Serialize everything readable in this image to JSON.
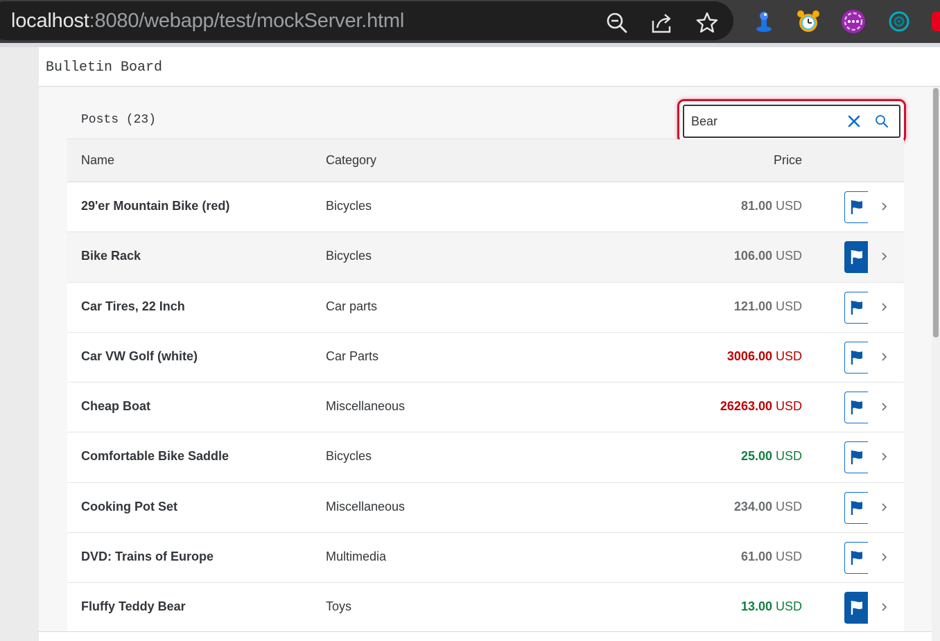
{
  "browser": {
    "url_host": "localhost",
    "url_rest": ":8080/webapp/test/mockServer.html",
    "icons": [
      "zoom-out-icon",
      "share-icon",
      "bookmark-star-icon"
    ],
    "extensions": [
      "inspector-extension-icon",
      "alarm-clock-extension-icon",
      "purple-extension-icon",
      "teal-extension-icon"
    ]
  },
  "app": {
    "title": "Bulletin Board"
  },
  "table": {
    "title": "Posts (23)",
    "search": {
      "value": "Bear",
      "placeholder": "Search"
    },
    "columns": {
      "name": "Name",
      "category": "Category",
      "price": "Price"
    },
    "rows": [
      {
        "name": "29'er Mountain Bike (red)",
        "category": "Bicycles",
        "price": "81.00",
        "currency": "USD",
        "state": "neutral",
        "flagged": false
      },
      {
        "name": "Bike Rack",
        "category": "Bicycles",
        "price": "106.00",
        "currency": "USD",
        "state": "neutral",
        "flagged": true
      },
      {
        "name": "Car Tires, 22 Inch",
        "category": "Car parts",
        "price": "121.00",
        "currency": "USD",
        "state": "neutral",
        "flagged": false
      },
      {
        "name": "Car VW Golf (white)",
        "category": "Car Parts",
        "price": "3006.00",
        "currency": "USD",
        "state": "error",
        "flagged": false
      },
      {
        "name": "Cheap Boat",
        "category": "Miscellaneous",
        "price": "26263.00",
        "currency": "USD",
        "state": "error",
        "flagged": false
      },
      {
        "name": "Comfortable Bike Saddle",
        "category": "Bicycles",
        "price": "25.00",
        "currency": "USD",
        "state": "success",
        "flagged": false
      },
      {
        "name": "Cooking Pot Set",
        "category": "Miscellaneous",
        "price": "234.00",
        "currency": "USD",
        "state": "neutral",
        "flagged": false
      },
      {
        "name": "DVD: Trains of Europe",
        "category": "Multimedia",
        "price": "61.00",
        "currency": "USD",
        "state": "neutral",
        "flagged": false
      },
      {
        "name": "Fluffy Teddy Bear",
        "category": "Toys",
        "price": "13.00",
        "currency": "USD",
        "state": "success",
        "flagged": true
      }
    ]
  },
  "colors": {
    "accent": "#0a6ed1",
    "error": "#bb0000",
    "success": "#107e3e",
    "focus": "#d0102b"
  }
}
